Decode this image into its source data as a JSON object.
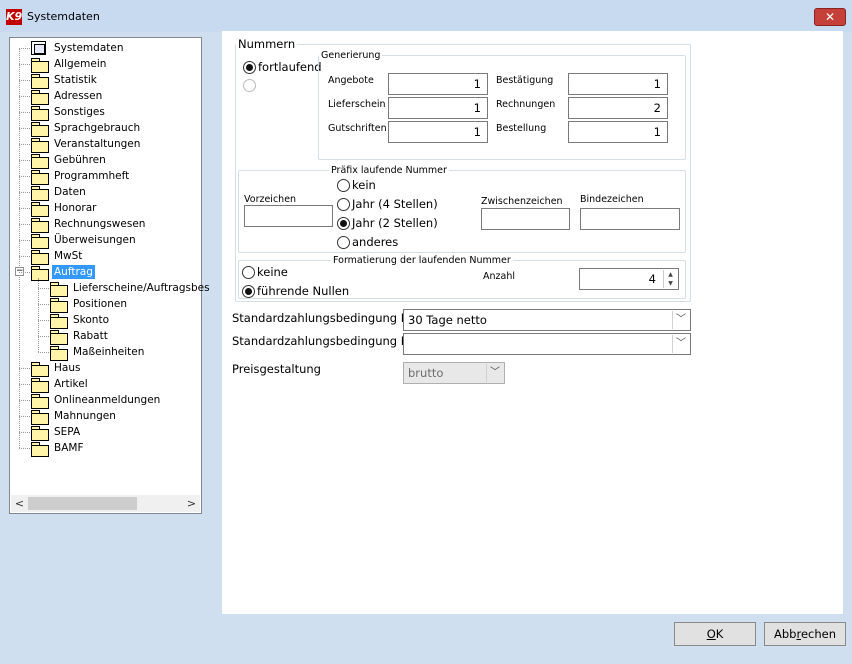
{
  "window": {
    "title": "Systemdaten",
    "app_icon": "K9",
    "close_label": "✕"
  },
  "tree": {
    "root": "Systemdaten",
    "items": [
      {
        "label": "Allgemein"
      },
      {
        "label": "Statistik"
      },
      {
        "label": "Adressen"
      },
      {
        "label": "Sonstiges"
      },
      {
        "label": "Sprachgebrauch"
      },
      {
        "label": "Veranstaltungen"
      },
      {
        "label": "Gebühren"
      },
      {
        "label": "Programmheft"
      },
      {
        "label": "Daten"
      },
      {
        "label": "Honorar"
      },
      {
        "label": "Rechnungswesen"
      },
      {
        "label": "Überweisungen"
      },
      {
        "label": "MwSt"
      },
      {
        "label": "Auftrag",
        "selected": true,
        "expander": "⊟"
      },
      {
        "label": "Haus"
      },
      {
        "label": "Artikel"
      },
      {
        "label": "Onlineanmeldungen"
      },
      {
        "label": "Mahnungen"
      },
      {
        "label": "SEPA"
      },
      {
        "label": "BAMF"
      }
    ],
    "auftrag_children": [
      "Lieferscheine/Auftragsbes",
      "Positionen",
      "Skonto",
      "Rabatt",
      "Maßeinheiten"
    ],
    "scroll_left": "<",
    "scroll_right": ">"
  },
  "nummern": {
    "title": "Nummern",
    "radio_fortlaufend": "fortlaufend",
    "generierung": {
      "title": "Generierung",
      "angebote_label": "Angebote",
      "angebote_value": "1",
      "lieferschein_label": "Lieferschein",
      "lieferschein_value": "1",
      "gutschriften_label": "Gutschriften",
      "gutschriften_value": "1",
      "bestaetigung_label": "Bestätigung",
      "bestaetigung_value": "1",
      "rechnungen_label": "Rechnungen",
      "rechnungen_value": "2",
      "bestellung_label": "Bestellung",
      "bestellung_value": "1"
    },
    "praefix": {
      "title": "Präfix laufende Nummer",
      "vorzeichen_label": "Vorzeichen",
      "options": {
        "kein": "kein",
        "jahr4": "Jahr (4 Stellen)",
        "jahr2": "Jahr (2 Stellen)",
        "anderes": "anderes"
      },
      "selected": "jahr2",
      "zwischenzeichen_label": "Zwischenzeichen",
      "bindezeichen_label": "Bindezeichen"
    },
    "formatierung": {
      "title": "Formatierung der laufenden Nummer",
      "keine": "keine",
      "fuehrende_nullen": "führende Nullen",
      "selected": "fuehrende_nullen",
      "anzahl_label": "Anzahl",
      "anzahl_value": "4"
    }
  },
  "zahlung": {
    "bedingung1_label": "Standardzahlungsbedingung I",
    "bedingung1_value": "30 Tage netto",
    "bedingung2_label": "Standardzahlungsbedingung II",
    "bedingung2_value": "",
    "preis_label": "Preisgestaltung",
    "preis_value": "brutto"
  },
  "buttons": {
    "ok": "OK",
    "cancel": "Abbrechen"
  },
  "colors": {
    "window_bg": "#cfdff0",
    "selection": "#3399ff",
    "close": "#c6403a"
  }
}
